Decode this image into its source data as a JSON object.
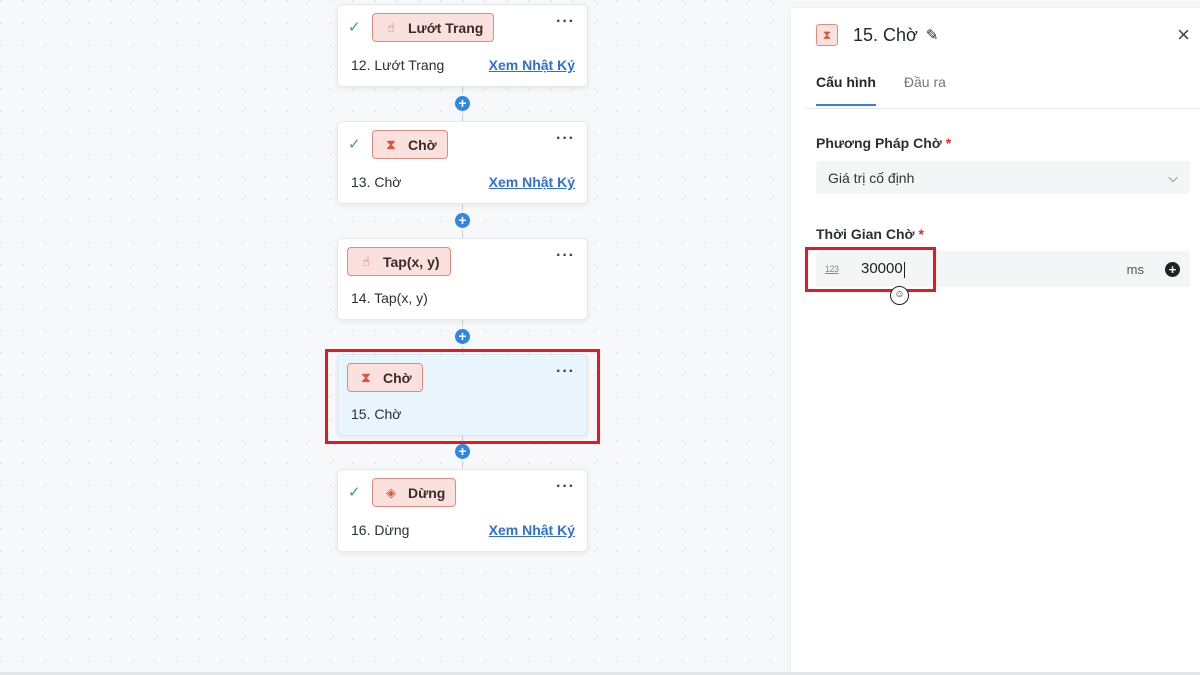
{
  "nodes": [
    {
      "chip": "Lướt Trang",
      "title": "12. Lướt Trang",
      "link": "Xem Nhật Ký",
      "icon": "swipe-icon"
    },
    {
      "chip": "Chờ",
      "title": "13. Chờ",
      "link": "Xem Nhật Ký",
      "icon": "hourglass-icon"
    },
    {
      "chip": "Tap(x, y)",
      "title": "14. Tap(x, y)",
      "link": "",
      "icon": "tap-hand-icon"
    },
    {
      "chip": "Chờ",
      "title": "15. Chờ",
      "link": "",
      "icon": "hourglass-icon"
    },
    {
      "chip": "Dừng",
      "title": "16. Dừng",
      "link": "Xem Nhật Ký",
      "icon": "stop-sign-icon"
    }
  ],
  "panel": {
    "title": "15. Chờ",
    "tabs": [
      "Cấu hình",
      "Đầu ra"
    ],
    "wait_method_label": "Phương Pháp Chờ",
    "wait_method_value": "Giá trị cố định",
    "wait_time_label": "Thời Gian Chờ",
    "wait_time_value": "30000",
    "wait_time_unit": "ms",
    "number_icon_text": "123"
  },
  "colors": {
    "accent": "#2f86e6",
    "chip_bg": "#fbe1dd",
    "chip_border": "#e08a80",
    "highlight": "#e11b23",
    "selected_bg": "#eaf4fd"
  }
}
